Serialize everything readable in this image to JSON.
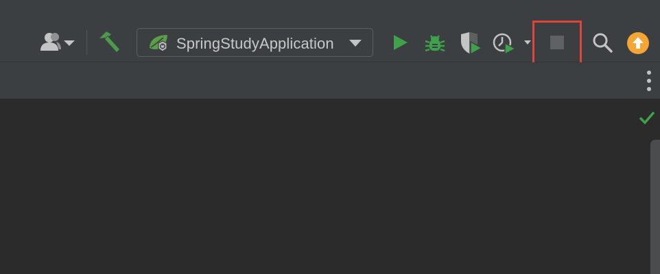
{
  "toolbar": {
    "user_icon": "user-dropdown-icon",
    "build_icon": "hammer-icon",
    "run_configuration": {
      "label": "SpringStudyApplication",
      "icon": "spring-boot-icon",
      "dropdown_icon": "triangle-down-icon"
    },
    "run_icon": "play-icon",
    "debug_icon": "bug-icon",
    "coverage_icon": "shield-run-icon",
    "profile_icon": "profiler-icon",
    "profile_dropdown_icon": "triangle-down-icon",
    "stop_icon": "stop-icon",
    "search_icon": "search-icon",
    "update_icon": "update-arrow-icon"
  },
  "editor": {
    "status_icon": "checkmark-icon"
  },
  "colors": {
    "toolbar_bg": "#3c3f41",
    "editor_bg": "#2b2b2b",
    "green": "#3fa14a",
    "highlight": "#e0453a",
    "update_orange": "#f4a534"
  }
}
